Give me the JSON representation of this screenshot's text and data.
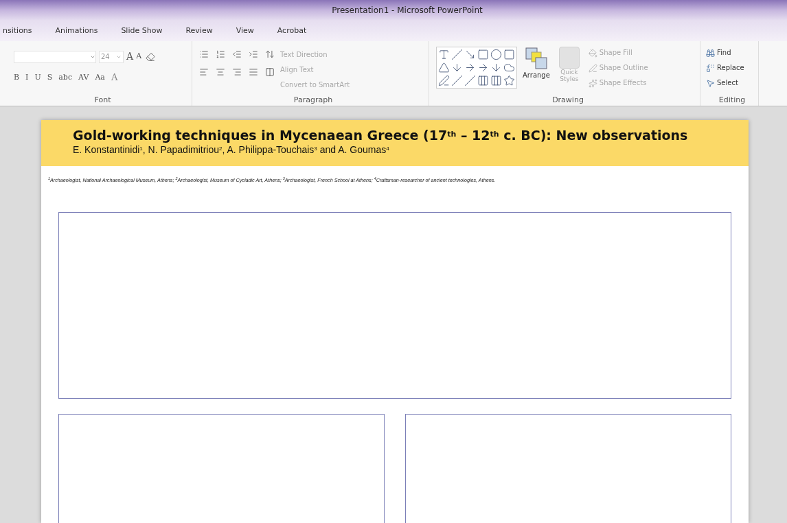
{
  "window": {
    "title": "Presentation1 - Microsoft PowerPoint"
  },
  "tabs": [
    "nsitions",
    "Animations",
    "Slide Show",
    "Review",
    "View",
    "Acrobat"
  ],
  "ribbon": {
    "font": {
      "label": "Font",
      "size": "24",
      "grow": "A",
      "shrink": "A",
      "format_buttons": [
        "B",
        "I",
        "U",
        "S",
        "abc",
        "AV",
        "Aa"
      ],
      "font_color": "A"
    },
    "paragraph": {
      "label": "Paragraph",
      "commands": [
        {
          "label": "Text Direction",
          "disabled": true
        },
        {
          "label": "Align Text",
          "disabled": true
        },
        {
          "label": "Convert to SmartArt",
          "disabled": true
        }
      ]
    },
    "drawing": {
      "label": "Drawing",
      "arrange": {
        "label": "Arrange",
        "disabled": false
      },
      "quick_styles": {
        "label": "Quick Styles",
        "disabled": true
      },
      "commands": [
        {
          "label": "Shape Fill",
          "disabled": true
        },
        {
          "label": "Shape Outline",
          "disabled": true
        },
        {
          "label": "Shape Effects",
          "disabled": true
        }
      ]
    },
    "editing": {
      "label": "Editing",
      "commands": [
        {
          "label": "Find",
          "kind": "find",
          "disabled": false
        },
        {
          "label": "Replace",
          "kind": "replace",
          "disabled": false
        },
        {
          "label": "Select",
          "kind": "select",
          "disabled": false
        }
      ]
    }
  },
  "slide": {
    "title": "Gold-working techniques in Mycenaean Greece (17$^{th}$ – 12$^{th}$ c. BC): New observations",
    "authors": "E. Konstantinidi$^{1}$, N. Papadimitriou$^{2}$, A. Philippa-Touchais$^{3}$ and A. Goumas$^{4}$",
    "affiliations": "$^{1}$Archaeologist, National Archaeological Museum, Athens; $^{2}$Archaeologist, Museum of Cycladic Art, Athens; $^{3}$Archaeologist, French School at Athens; $^{4}$Craftsman-researcher of ancient technologies, Athens."
  }
}
